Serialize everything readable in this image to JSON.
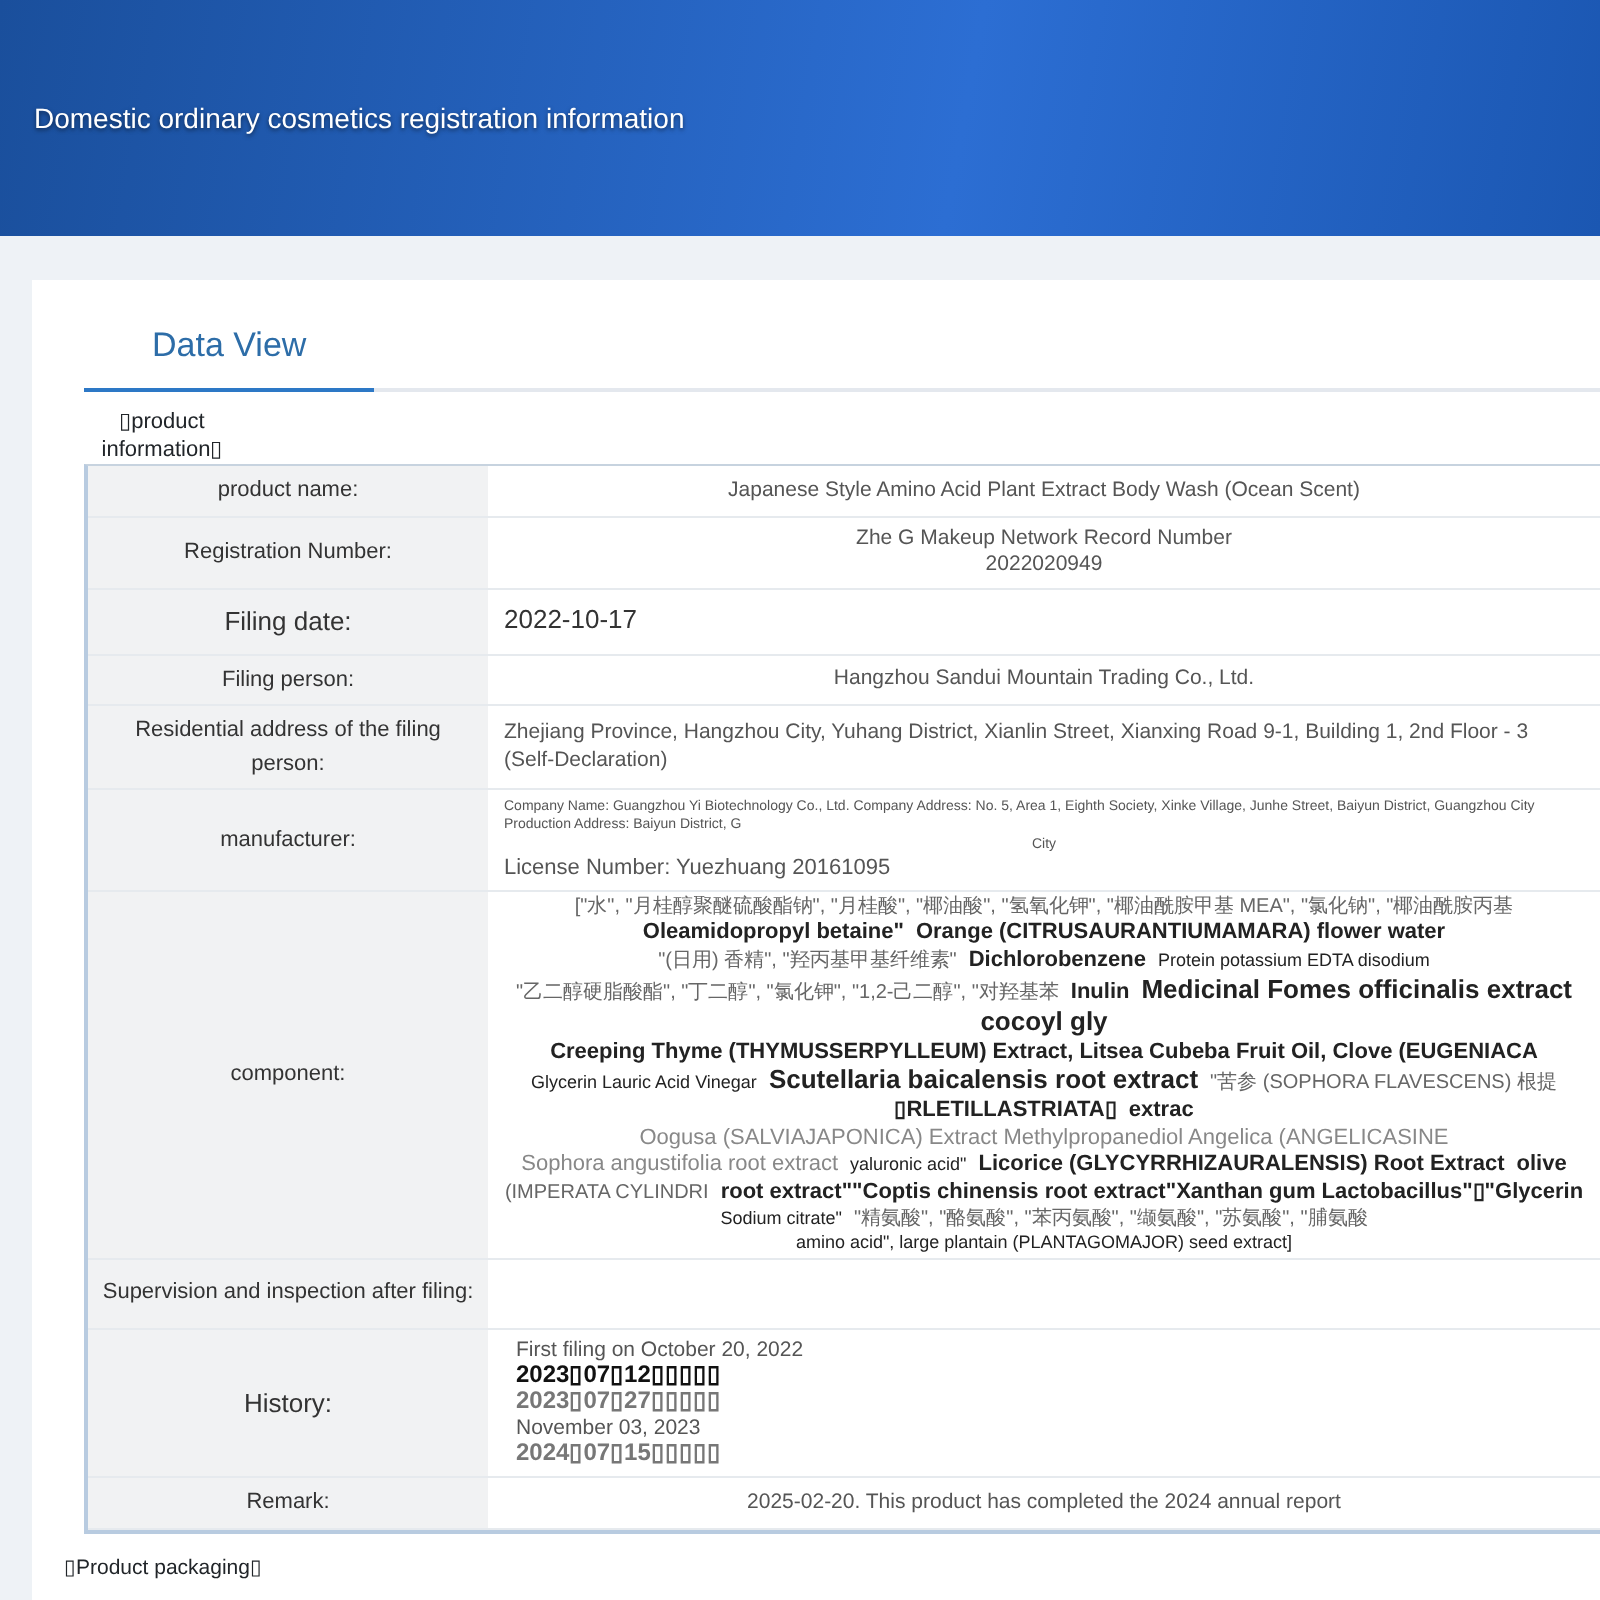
{
  "header": {
    "title": "Domestic ordinary cosmetics registration information"
  },
  "tabs": [
    {
      "label": "Data View",
      "selected": true
    }
  ],
  "section": {
    "legend": "▯product information▯"
  },
  "fields": [
    {
      "label": "product name:",
      "kind": "text",
      "lines": [
        "Japanese Style Amino Acid Plant Extract Body Wash (Ocean Scent)"
      ]
    },
    {
      "label": "Registration Number:",
      "kind": "text",
      "lines": [
        "Zhe G Makeup Network Record Number",
        "2022020949"
      ]
    },
    {
      "label": "Filing date:",
      "kind": "date",
      "lines": [
        "2022-10-17"
      ]
    },
    {
      "label": "Filing person:",
      "kind": "text",
      "lines": [
        "Hangzhou Sandui Mountain Trading Co., Ltd."
      ]
    },
    {
      "label": "Residential address of the filing person:",
      "kind": "text",
      "lines": [
        "Zhejiang Province, Hangzhou City, Yuhang District, Xianlin Street, Xianxing Road 9-1, Building 1, 2nd Floor - 3 (Self-Declaration)"
      ]
    },
    {
      "label": "manufacturer:",
      "kind": "manufacturer",
      "lines": [
        "Company Name: Guangzhou Yi Biotechnology Co., Ltd. Company Address: No. 5, Area 1, Eighth Society, Xinke Village, Junhe Street, Baiyun District, Guangzhou City Production Address: Baiyun District, G",
        "City",
        "License Number: Yuezhuang 20161095"
      ]
    },
    {
      "label": "component:",
      "kind": "component",
      "fragments": [
        {
          "text": "[\"水\", \"月桂醇聚醚硫酸酯钠\", \"月桂酸\", \"椰油酸\", \"氢氧化钾\", \"椰油酰胺甲基 MEA\", \"氯化钠\", \"椰油酰胺丙基",
          "kind": "chinese"
        },
        {
          "text": "Oleamidopropyl betaine\"",
          "kind": "medium"
        },
        {
          "text": "Orange (CITRUSAURANTIUMAMARA) flower water",
          "kind": "medium"
        },
        {
          "text": "\"(日用) 香精\", \"羟丙基甲基纤维素\"",
          "kind": "chinese"
        },
        {
          "text": "Dichlorobenzene",
          "kind": "medium"
        },
        {
          "text": "Protein potassium EDTA disodium",
          "kind": "small"
        },
        {
          "text": "\"乙二醇硬脂酸酯\", \"丁二醇\", \"氯化钾\", \"1,2-己二醇\", \"对羟基苯",
          "kind": "chinese"
        },
        {
          "text": "Inulin",
          "kind": "medium"
        },
        {
          "text": "Medicinal Fomes officinalis extract",
          "kind": "large"
        },
        {
          "text": "cocoyl gly",
          "kind": "large"
        },
        {
          "text": "Creeping Thyme (THYMUSSERPYLLEUM) Extract, Litsea Cubeba Fruit Oil, Clove (EUGENIACA",
          "kind": "medium"
        },
        {
          "text": "Glycerin Lauric Acid Vinegar",
          "kind": "small"
        },
        {
          "text": "Scutellaria baicalensis root extract",
          "kind": "large"
        },
        {
          "text": "\"苦参 (SOPHORA FLAVESCENS) 根提",
          "kind": "chinese"
        },
        {
          "text": "▯RLETILLASTRIATA▯",
          "kind": "medium"
        },
        {
          "text": "extrac",
          "kind": "medium"
        },
        {
          "text": "Oogusa (SALVIAJAPONICA) Extract Methylpropanediol Angelica (ANGELICASINE",
          "kind": "faded"
        },
        {
          "text": "Sophora angustifolia root extract",
          "kind": "faded"
        },
        {
          "text": "yaluronic acid\"",
          "kind": "small"
        },
        {
          "text": "Licorice (GLYCYRRHIZAURALENSIS) Root Extract",
          "kind": "medium"
        },
        {
          "text": "olive",
          "kind": "medium"
        },
        {
          "text": "(IMPERATA CYLINDRI",
          "kind": "chinese"
        },
        {
          "text": "root extract\"\"Coptis chinensis root extract\"Xanthan gum Lactobacillus\"▯\"Glycerin",
          "kind": "medium"
        },
        {
          "text": "Sodium citrate\"",
          "kind": "small"
        },
        {
          "text": "\"精氨酸\", \"酪氨酸\", \"苯丙氨酸\", \"缬氨酸\", \"苏氨酸\", \"脯氨酸",
          "kind": "chinese"
        },
        {
          "text": "amino acid\", large plantain (PLANTAGOMAJOR) seed extract]",
          "kind": "small"
        }
      ]
    },
    {
      "label": "Supervision and inspection after filing:",
      "kind": "text"
    },
    {
      "label": "History:",
      "kind": "history",
      "entries": [
        {
          "text": "First filing on October 20, 2022",
          "kind": "plain"
        },
        {
          "text": "2023▯07▯12▯▯▯▯▯",
          "kind": "dark"
        },
        {
          "text": "2023▯07▯27▯▯▯▯▯",
          "kind": "grey"
        },
        {
          "text": "November 03, 2023",
          "kind": "plain"
        },
        {
          "text": "2024▯07▯15▯▯▯▯▯",
          "kind": "grey"
        }
      ]
    },
    {
      "label": "Remark:",
      "kind": "text",
      "lines": [
        "2025-02-20. This product has completed the 2024 annual report"
      ]
    }
  ],
  "footer": {
    "heading": "▯Product packaging▯"
  }
}
